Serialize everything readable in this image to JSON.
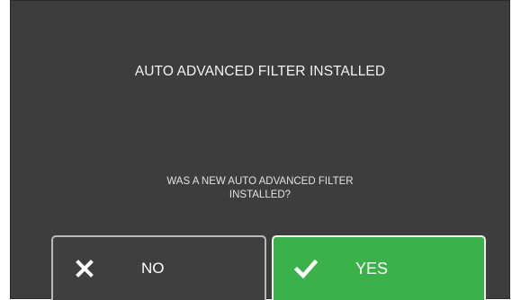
{
  "dialog": {
    "title": "AUTO ADVANCED FILTER INSTALLED",
    "question_line1": "WAS A NEW AUTO ADVANCED FILTER",
    "question_line2": "INSTALLED?",
    "buttons": {
      "no": {
        "label": "NO",
        "icon": "close-icon"
      },
      "yes": {
        "label": "YES",
        "icon": "checkmark-icon"
      }
    },
    "colors": {
      "background": "#3d3d3d",
      "yes_button": "#3bb14a",
      "no_button": "#3f3f3f",
      "text": "#ffffff"
    }
  }
}
